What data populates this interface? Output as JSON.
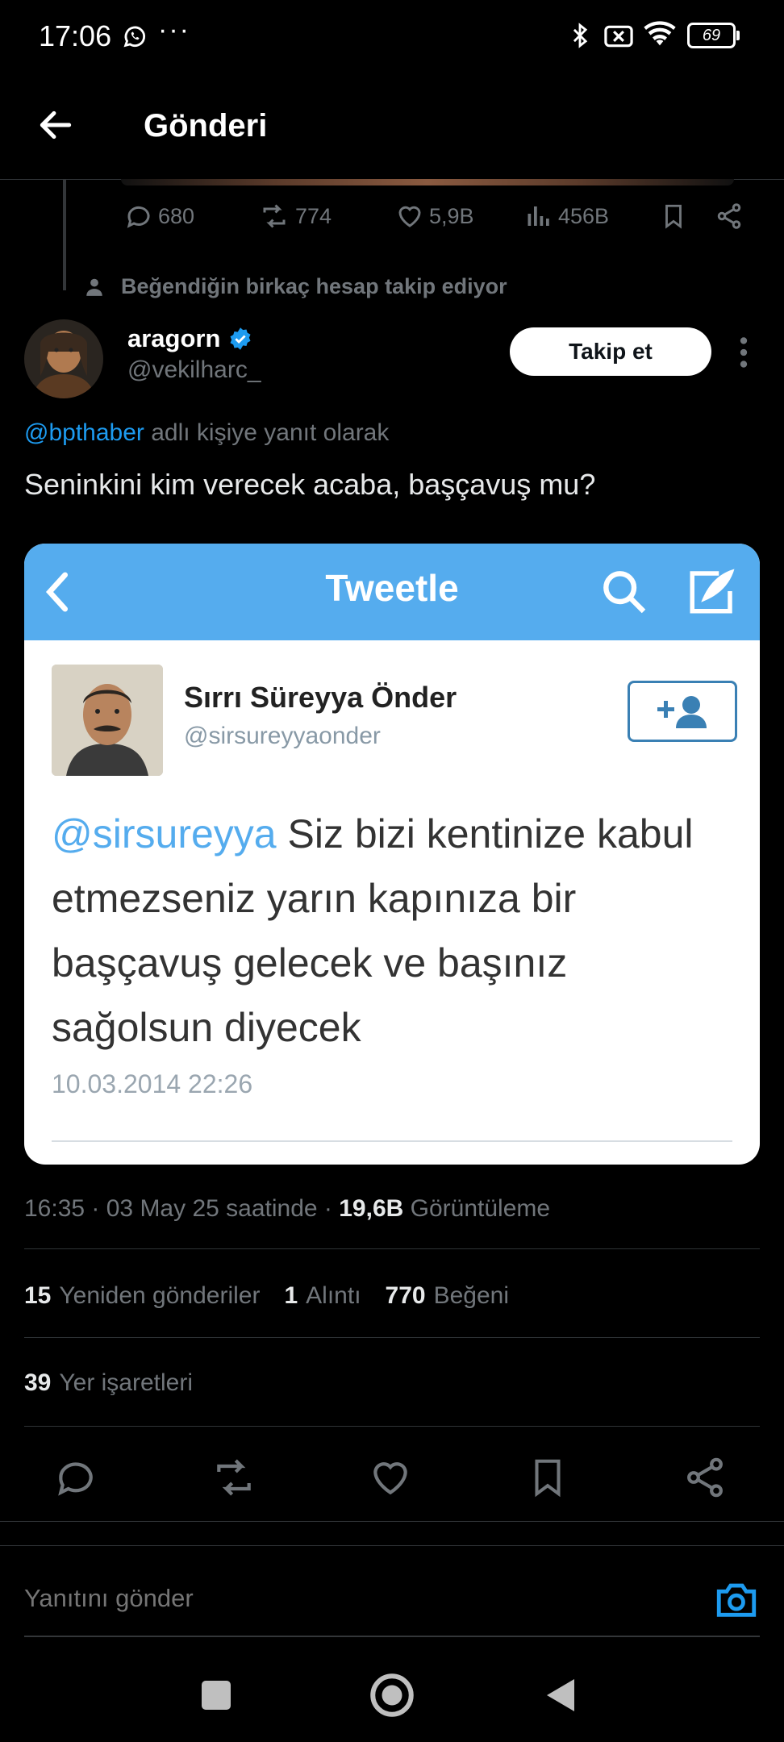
{
  "status_bar": {
    "time": "17:06",
    "dots": "···",
    "battery": "69"
  },
  "header": {
    "title": "Gönderi"
  },
  "previous_post": {
    "replies": "680",
    "reposts": "774",
    "likes": "5,9B",
    "views": "456B"
  },
  "social_context": "Beğendiğin birkaç hesap takip ediyor",
  "author": {
    "name": "aragorn",
    "handle": "@vekilharc_",
    "follow_label": "Takip et"
  },
  "reply_to": {
    "mention": "@bpthaber",
    "suffix": " adlı kişiye yanıt olarak"
  },
  "tweet_text": "Seninkini kim verecek acaba, başçavuş mu?",
  "embedded": {
    "bar_title": "Tweetle",
    "name": "Sırrı Süreyya Önder",
    "handle": "@sirsureyyaonder",
    "mention": "@sirsureyya",
    "text": " Siz bizi kentinize kabul etmezseniz yarın kapınıza bir başçavuş gelecek ve başınız sağolsun diyecek",
    "date": "10.03.2014 22:26"
  },
  "meta": {
    "time": "16:35 · 03 May 25 saatinde · ",
    "views": "19,6B",
    "views_label": " Görüntüleme"
  },
  "stats": {
    "reposts_count": "15",
    "reposts_label": "Yeniden gönderiler",
    "quotes_count": "1",
    "quotes_label": "Alıntı",
    "likes_count": "770",
    "likes_label": "Beğeni",
    "bookmarks_count": "39",
    "bookmarks_label": "Yer işaretleri"
  },
  "reply_box": {
    "placeholder": "Yanıtını gönder"
  },
  "colors": {
    "accent": "#1d9bf0",
    "background": "#000000",
    "muted": "#71767b",
    "twitter_blue_legacy": "#55acee"
  },
  "icons": [
    "whatsapp-icon",
    "bluetooth-icon",
    "wifi-icon",
    "back-arrow-icon",
    "reply-icon",
    "repost-icon",
    "like-icon",
    "views-icon",
    "bookmark-icon",
    "share-icon",
    "person-icon",
    "verified-badge-icon",
    "more-icon",
    "search-icon",
    "compose-icon",
    "add-user-icon",
    "camera-icon"
  ]
}
